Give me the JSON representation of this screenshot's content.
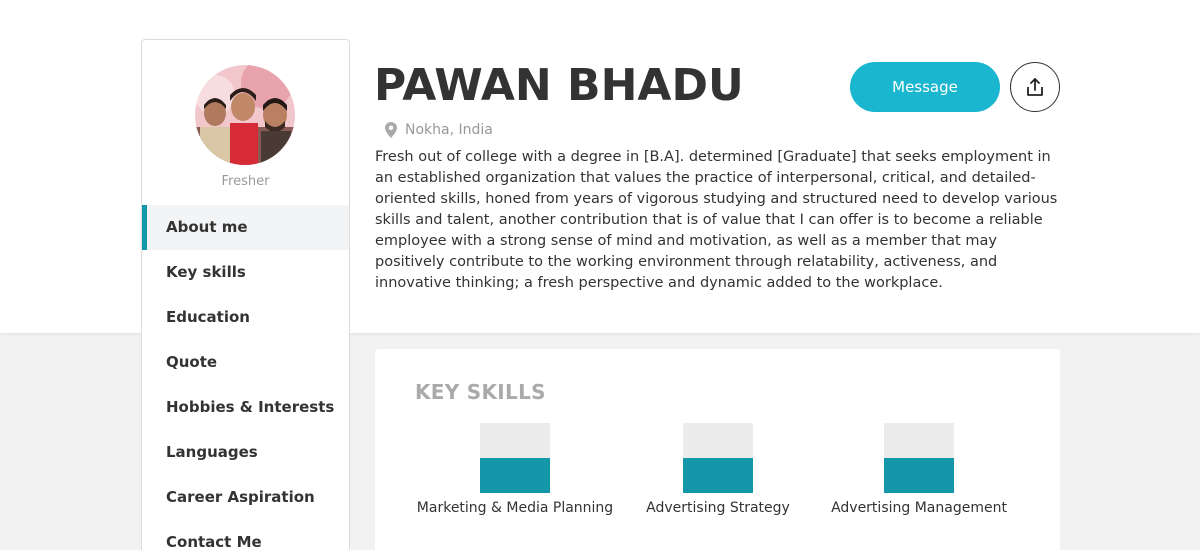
{
  "profile": {
    "name": "PAWAN BHADU",
    "role": "Fresher",
    "location": "Nokha, India",
    "bio": "Fresh out of college with a degree in [B.A]. determined [Graduate] that seeks employment in an established organization that values the practice of interpersonal, critical, and detailed-oriented skills, honed from years of vigorous studying and structured need to develop various skills and talent, another contribution that is of value that I can offer is to become a reliable employee with a strong sense of mind and motivation, as well as a member that may positively contribute to the working environment through relatability, activeness, and innovative thinking; a fresh perspective and dynamic added to the workplace."
  },
  "actions": {
    "message_label": "Message",
    "share_icon": "share-icon"
  },
  "sidebar": {
    "items": [
      {
        "label": "About me",
        "active": true
      },
      {
        "label": "Key skills",
        "active": false
      },
      {
        "label": "Education",
        "active": false
      },
      {
        "label": "Quote",
        "active": false
      },
      {
        "label": "Hobbies & Interests",
        "active": false
      },
      {
        "label": "Languages",
        "active": false
      },
      {
        "label": "Career Aspiration",
        "active": false
      },
      {
        "label": "Contact Me",
        "active": false
      }
    ]
  },
  "key_skills": {
    "title": "KEY SKILLS",
    "items": [
      {
        "label": "Marketing & Media Planning",
        "level": 0.5
      },
      {
        "label": "Advertising Strategy",
        "level": 0.5
      },
      {
        "label": "Advertising Management",
        "level": 0.5
      }
    ]
  },
  "colors": {
    "accent": "#1597aa",
    "button": "#1ab5cf",
    "page_background": "#f2f2f2"
  },
  "icons": {
    "location": "map-pin-icon",
    "share": "share-icon"
  }
}
